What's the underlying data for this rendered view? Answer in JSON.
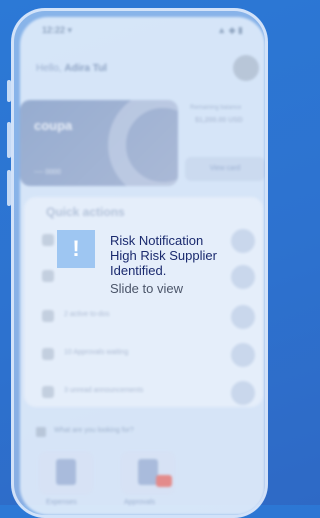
{
  "status": {
    "time": "12:22 ▾",
    "icons": "▲ ◆ ▮"
  },
  "greeting": {
    "prefix": "Hello,",
    "name": "Adira Tul"
  },
  "card": {
    "logo": "coupa",
    "number": "---- 0000"
  },
  "spend": {
    "label": "Remaining balance",
    "value": "$1,200.00 USD"
  },
  "view_card_label": "View card",
  "quick_actions": {
    "title": "Quick actions",
    "items": [
      {
        "label": ""
      },
      {
        "label": ""
      },
      {
        "label": "2 active to-dos"
      },
      {
        "label": "10 Approvals waiting"
      },
      {
        "label": "3 unread announcements"
      }
    ]
  },
  "search_prompt": "What are you looking for?",
  "tiles": [
    {
      "label": "Expenses"
    },
    {
      "label": "Approvals"
    }
  ],
  "notification": {
    "icon": "!",
    "title": "Risk Notification",
    "line2": "High Risk Supplier",
    "line3": "Identified.",
    "action": "Slide to view"
  }
}
